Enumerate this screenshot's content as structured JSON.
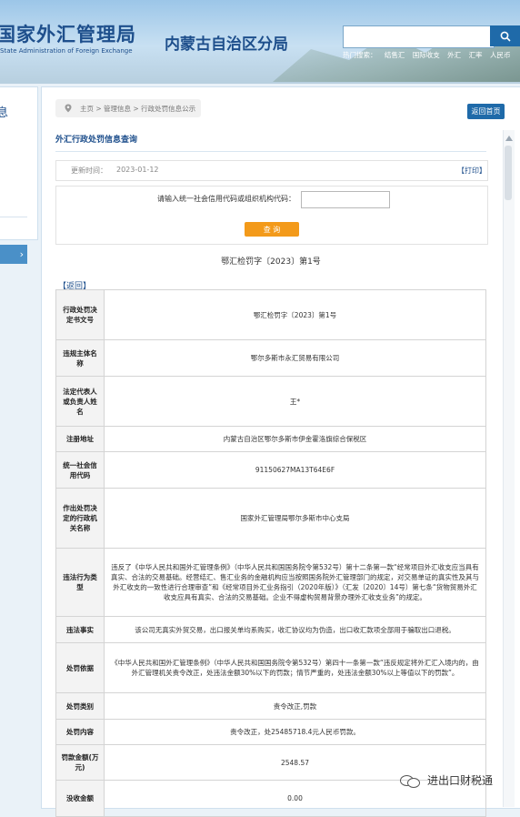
{
  "header": {
    "logo_title": "国家外汇管理局",
    "logo_subtitle": "State Administration of Foreign Exchange",
    "branch_title": "内蒙古自治区分局",
    "search_placeholder": "",
    "hot_label": "热门搜索：",
    "hot_items": [
      "结售汇",
      "国际收支",
      "外汇",
      "汇率",
      "人民币"
    ]
  },
  "sidebar": {
    "label": "息"
  },
  "breadcrumb": {
    "text": "主页 > 管理信息 > 行政处罚信息公示"
  },
  "back_home_label": "返回首页",
  "section_title": "外汇行政处罚信息查询",
  "update": {
    "label": "更新时间：",
    "date": "2023-01-12",
    "print_label": "【打印】"
  },
  "query": {
    "label": "请输入统一社会信用代码或组织机构代码：",
    "input_value": "",
    "button_label": "查 询"
  },
  "doc_number": "鄂汇检罚字〔2023〕第1号",
  "back_link": "【返回】",
  "details": [
    {
      "key": "行政处罚决定书文号",
      "value": "鄂汇检罚字〔2023〕第1号"
    },
    {
      "key": "违规主体名称",
      "value": "鄂尔多斯市永汇贸易有限公司"
    },
    {
      "key": "法定代表人或负责人姓名",
      "value": "王*"
    },
    {
      "key": "注册地址",
      "value": "内蒙古自治区鄂尔多斯市伊金霍洛旗综合保税区"
    },
    {
      "key": "统一社会信用代码",
      "value": "91150627MA13T64E6F"
    },
    {
      "key": "作出处罚决定的行政机关名称",
      "value": "国家外汇管理局鄂尔多斯市中心支局"
    },
    {
      "key": "违法行为类型",
      "value": "违反了《中华人民共和国外汇管理条例》（中华人民共和国国务院令第532号）第十二条第一款“经常项目外汇收支应当具有真实、合法的交易基础。经营结汇、售汇业务的金融机构应当按照国务院外汇管理部门的规定，对交易单证的真实性及其与外汇收支的一致性进行合理审查”和《经常项目外汇业务指引（2020年版）》（汇发〔2020〕14号）第七条“货物贸易外汇收支应具有真实、合法的交易基础。企业不得虚构贸易背景办理外汇收支业务”的规定。"
    },
    {
      "key": "违法事实",
      "value": "该公司无真实外贸交易，出口报关单均系购买，收汇协议均为伪造，出口收汇款项全部用于骗取出口退税。"
    },
    {
      "key": "处罚依据",
      "value": "《中华人民共和国外汇管理条例》（中华人民共和国国务院令第532号）第四十一条第一款“违反规定将外汇汇入境内的，由外汇管理机关责令改正，处违法金额30%以下的罚款；情节严重的，处违法金额30%以上等值以下的罚款”。"
    },
    {
      "key": "处罚类别",
      "value": "责令改正,罚款"
    },
    {
      "key": "处罚内容",
      "value": "责令改正，处25485718.4元人民币罚款。"
    },
    {
      "key": "罚款金额(万元)",
      "value": "2548.57"
    },
    {
      "key": "没收金额",
      "value": "0.00"
    }
  ],
  "watermark": "进出口财税通"
}
